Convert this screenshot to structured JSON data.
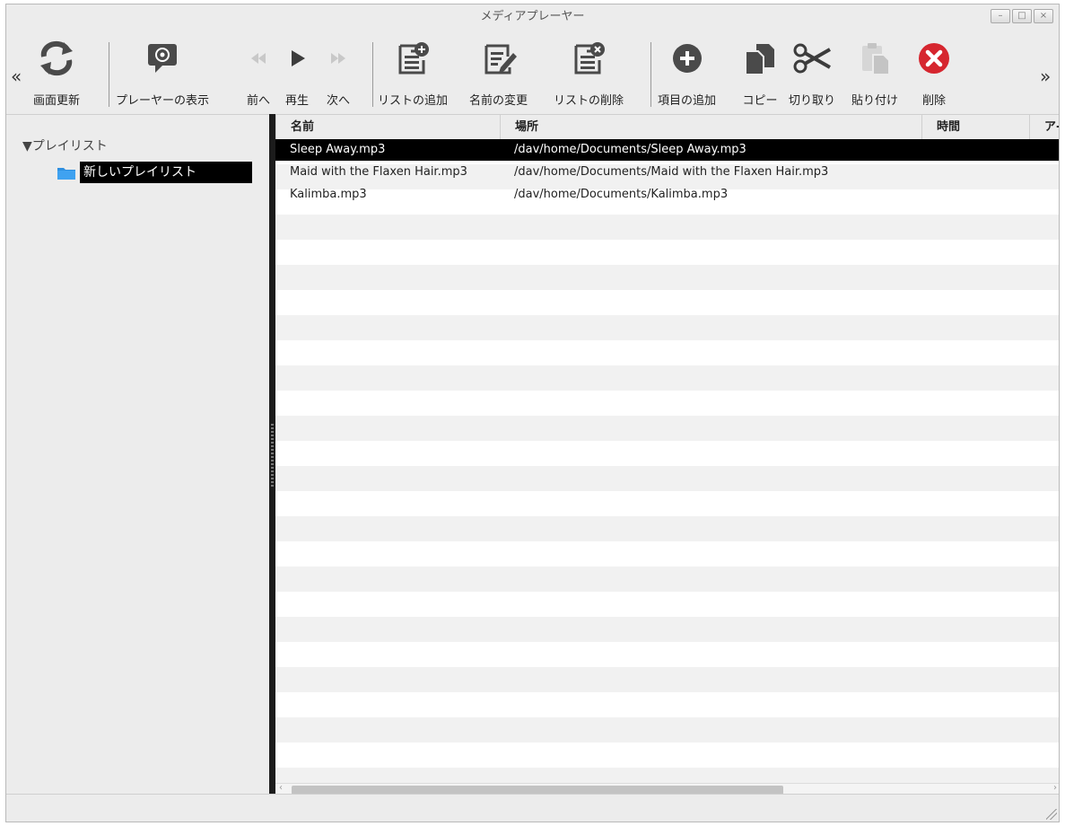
{
  "window": {
    "title": "メディアプレーヤー",
    "controls": {
      "minimize": "–",
      "maximize": "□",
      "close": "×"
    }
  },
  "toolbar": {
    "left_chevron": "«",
    "right_chevron": "»",
    "items": [
      {
        "label": "画面更新",
        "icon": "refresh-icon"
      },
      {
        "label": "プレーヤーの表示",
        "icon": "speech-bubble-icon"
      },
      {
        "label": "前へ",
        "icon": "previous-icon"
      },
      {
        "label": "再生",
        "icon": "play-icon"
      },
      {
        "label": "次へ",
        "icon": "next-icon"
      },
      {
        "label": "リストの追加",
        "icon": "list-add-icon"
      },
      {
        "label": "名前の変更",
        "icon": "rename-icon"
      },
      {
        "label": "リストの削除",
        "icon": "list-delete-icon"
      },
      {
        "label": "項目の追加",
        "icon": "add-circle-icon"
      },
      {
        "label": "コピー",
        "icon": "copy-icon"
      },
      {
        "label": "切り取り",
        "icon": "scissors-icon"
      },
      {
        "label": "貼り付け",
        "icon": "paste-icon"
      },
      {
        "label": "削除",
        "icon": "delete-icon"
      }
    ]
  },
  "sidebar": {
    "root_label": "▼プレイリスト",
    "selected_playlist": "新しいプレイリスト"
  },
  "table": {
    "columns": [
      "名前",
      "場所",
      "時間",
      "ア-"
    ],
    "rows": [
      {
        "name": "Sleep Away.mp3",
        "location": "/dav/home/Documents/Sleep Away.mp3",
        "selected": true
      },
      {
        "name": "Maid with the Flaxen Hair.mp3",
        "location": "/dav/home/Documents/Maid with the Flaxen Hair.mp3",
        "selected": false
      },
      {
        "name": "Kalimba.mp3",
        "location": "/dav/home/Documents/Kalimba.mp3",
        "selected": false
      }
    ],
    "scroll_left_arrow": "‹",
    "scroll_right_arrow": "›"
  },
  "colors": {
    "selection": "#000000",
    "delete_red": "#d6262f",
    "folder_blue": "#2e8fe0"
  }
}
